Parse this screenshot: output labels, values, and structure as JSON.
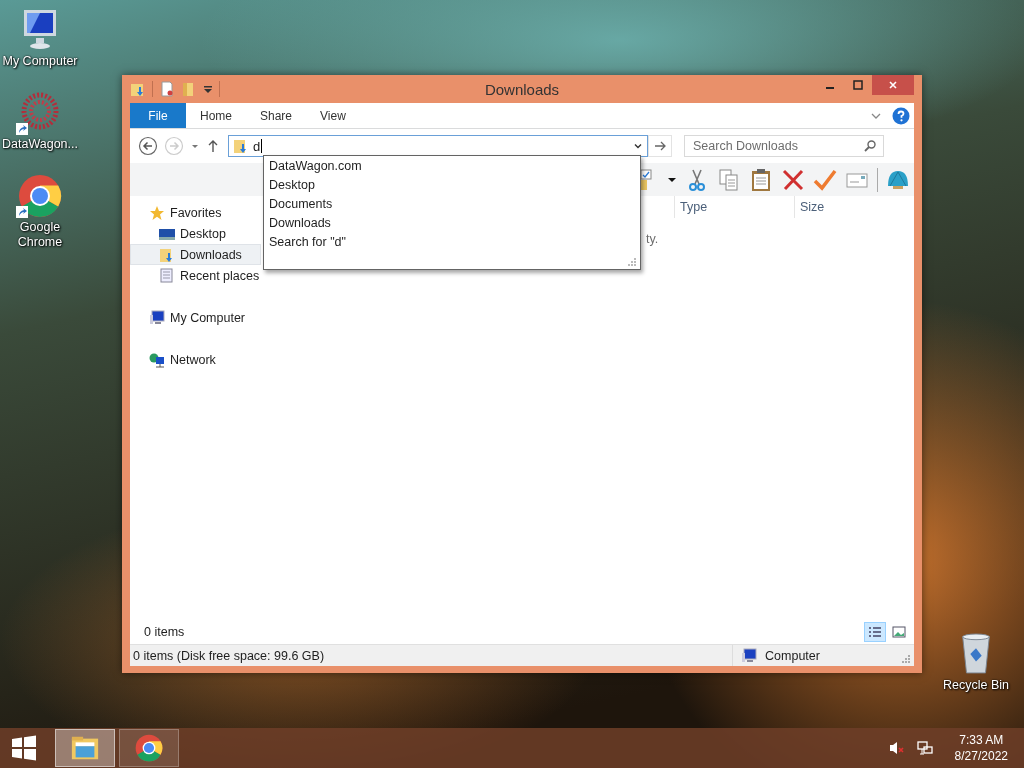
{
  "desktop_icons": [
    {
      "label": "My Computer",
      "kind": "computer",
      "shortcut": false
    },
    {
      "label": "DataWagon...",
      "kind": "datawagon",
      "shortcut": true
    },
    {
      "label": "Google Chrome",
      "kind": "chrome",
      "shortcut": true
    }
  ],
  "recycle_bin": {
    "label": "Recycle Bin"
  },
  "window": {
    "title": "Downloads",
    "ribbon_tabs": [
      {
        "label": "File",
        "kind": "file"
      },
      {
        "label": "Home",
        "kind": "tab"
      },
      {
        "label": "Share",
        "kind": "tab"
      },
      {
        "label": "View",
        "kind": "tab"
      }
    ],
    "address": {
      "value": "d"
    },
    "search": {
      "placeholder": "Search Downloads"
    },
    "autocomplete": [
      "DataWagon.com",
      "Desktop",
      "Documents",
      "Downloads",
      "Search for \"d\""
    ],
    "nav": [
      {
        "label": "Favorites",
        "kind": "favorites",
        "selected": false,
        "children": [
          {
            "label": "Desktop",
            "kind": "desktop",
            "selected": false
          },
          {
            "label": "Downloads",
            "kind": "downloads",
            "selected": true
          },
          {
            "label": "Recent places",
            "kind": "recent",
            "selected": false
          }
        ]
      },
      {
        "label": "My Computer",
        "kind": "computer",
        "selected": false
      },
      {
        "label": "Network",
        "kind": "network",
        "selected": false
      }
    ],
    "columns": [
      "Type",
      "Size"
    ],
    "empty_message": "ty.",
    "item_count": "0 items",
    "view_buttons": [
      {
        "kind": "details",
        "selected": true
      },
      {
        "kind": "large",
        "selected": false
      }
    ],
    "status_bar": {
      "text": "0 items (Disk free space: 99.6 GB)",
      "location": "Computer"
    }
  },
  "taskbar": {
    "apps": [
      {
        "kind": "explorer",
        "selected": true
      },
      {
        "kind": "chrome",
        "selected": false
      }
    ],
    "time": "7:33 AM",
    "date": "8/27/2022"
  }
}
